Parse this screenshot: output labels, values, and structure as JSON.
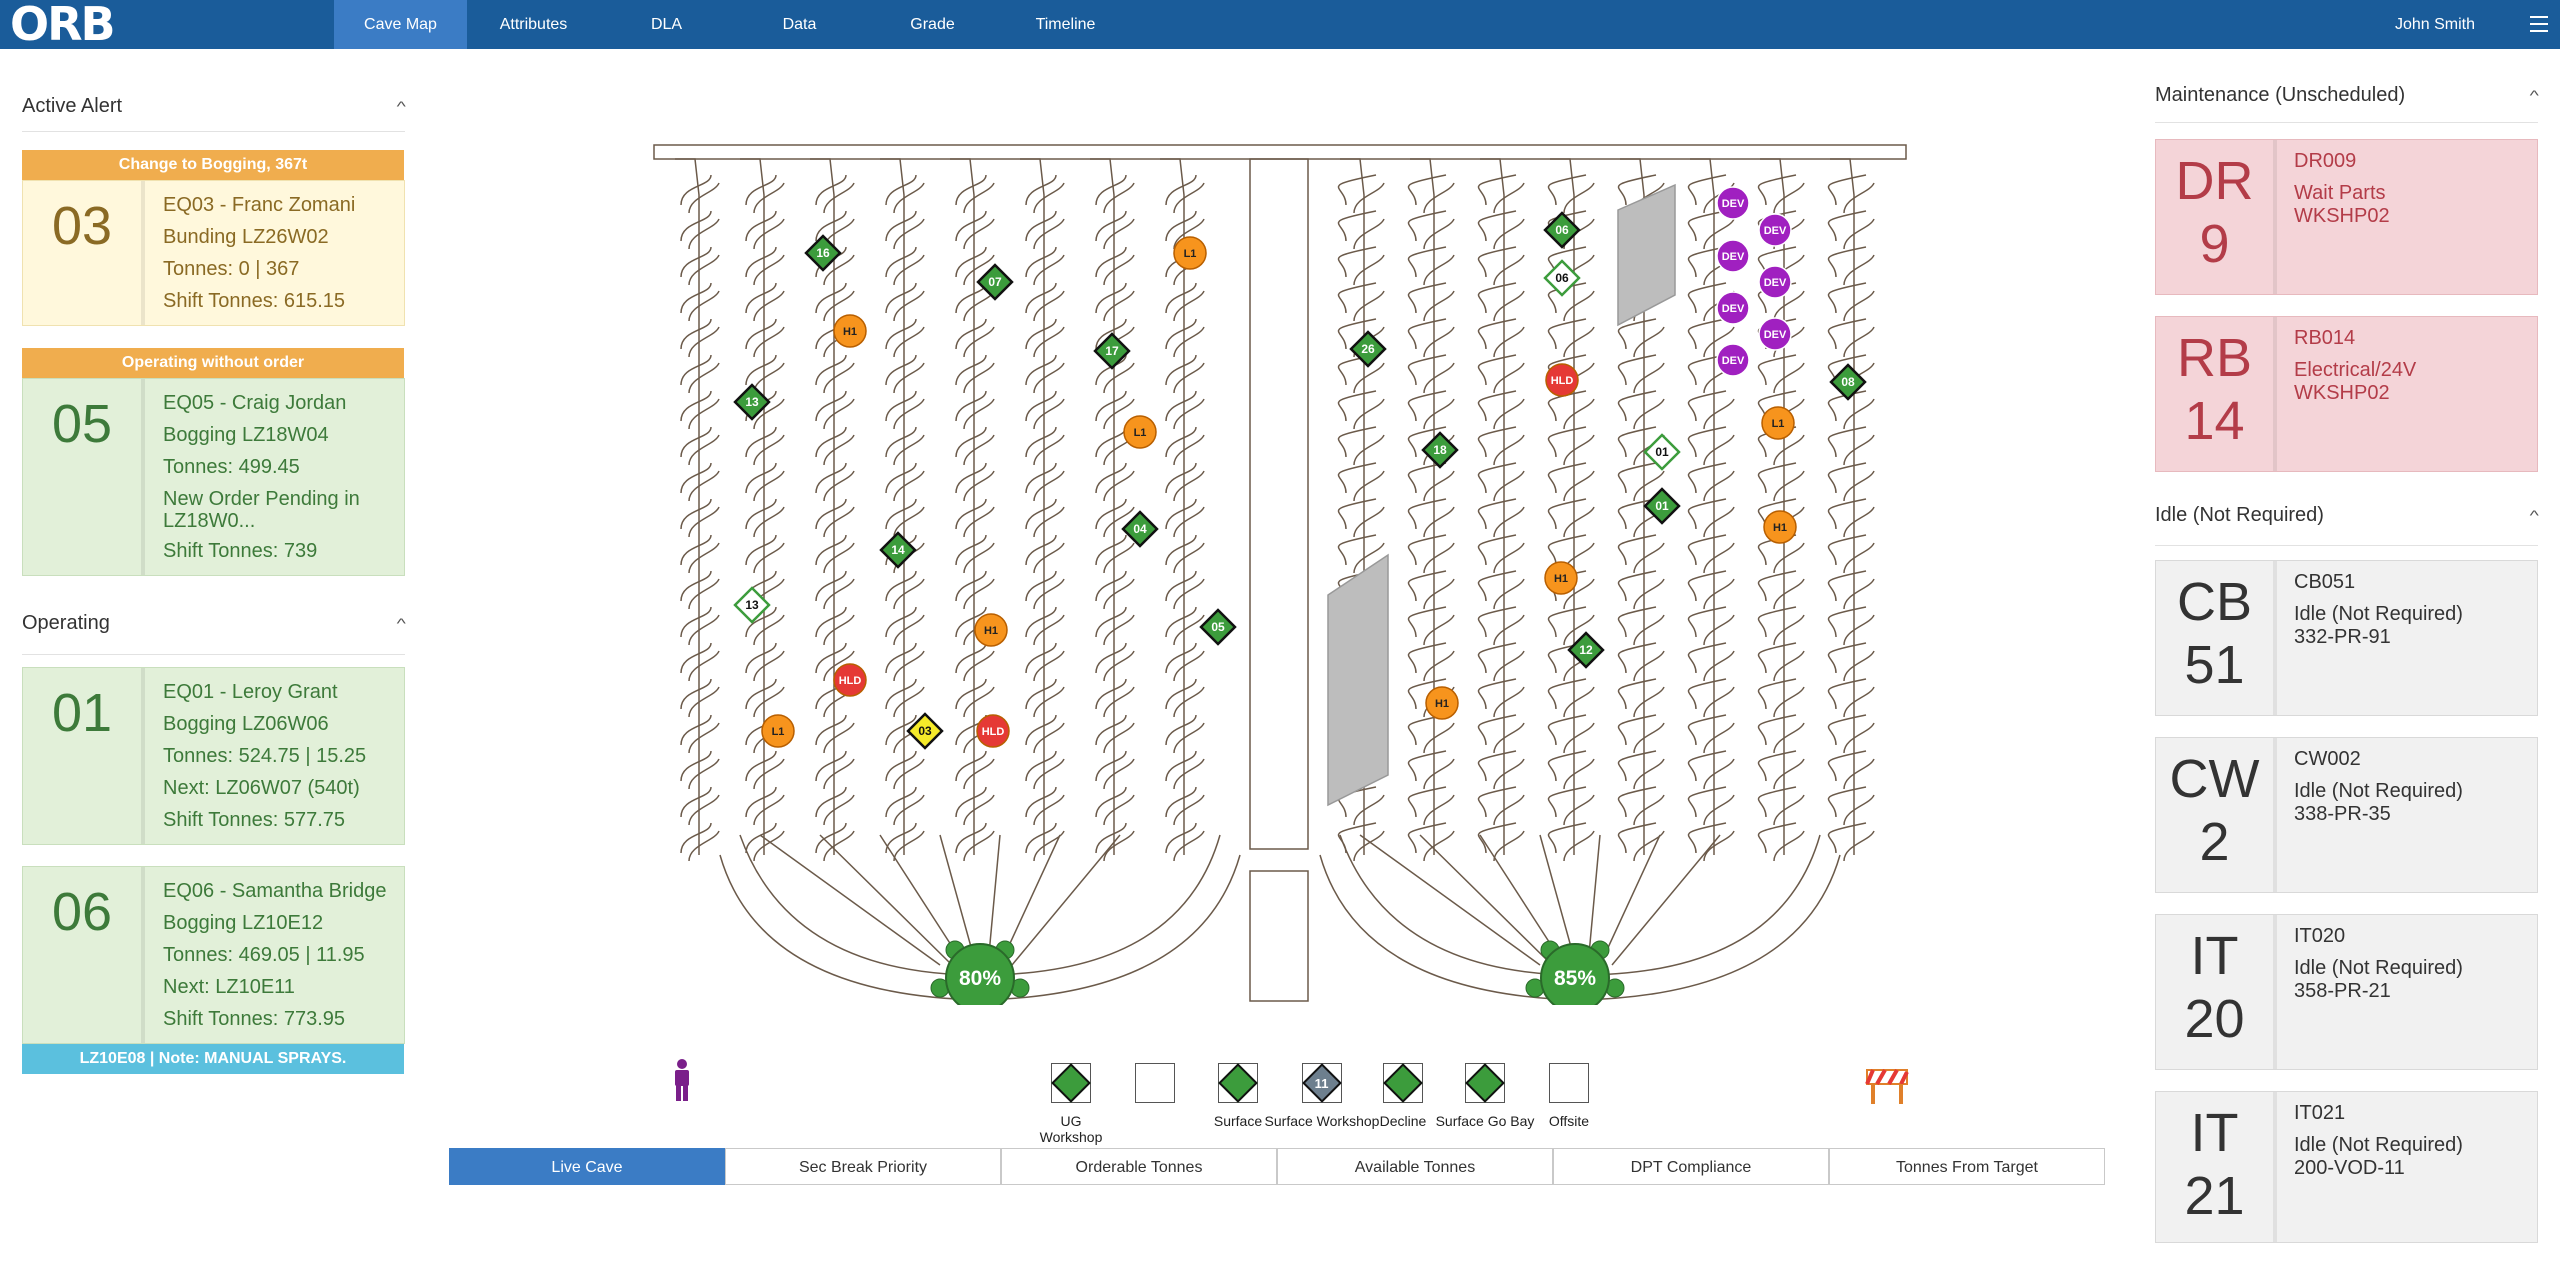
{
  "nav": {
    "logo": "ORB",
    "tabs": [
      "Cave Map",
      "Attributes",
      "DLA",
      "Data",
      "Grade",
      "Timeline"
    ],
    "user": "John Smith"
  },
  "active_alert": {
    "title": "Active Alert",
    "cards": [
      {
        "banner": "Change to Bogging, 367t",
        "num": "03",
        "lines": [
          "EQ03 - Franc Zomani",
          "Bunding LZ26W02",
          "Tonnes: 0 | 367",
          "Shift Tonnes: 615.15"
        ]
      },
      {
        "banner": "Operating without order",
        "num": "05",
        "lines": [
          "EQ05 - Craig Jordan",
          "Bogging LZ18W04",
          "Tonnes: 499.45",
          "New Order Pending in",
          "LZ18W0...",
          "Shift Tonnes: 739"
        ]
      }
    ]
  },
  "operating": {
    "title": "Operating",
    "cards": [
      {
        "num": "01",
        "lines": [
          "EQ01 - Leroy Grant",
          "Bogging LZ06W06",
          "Tonnes: 524.75 | 15.25",
          "Next: LZ06W07 (540t)",
          "Shift Tonnes: 577.75"
        ]
      },
      {
        "num": "06",
        "lines": [
          "EQ06 - Samantha Bridge",
          "Bogging LZ10E12",
          "Tonnes: 469.05 | 11.95",
          "Next: LZ10E11",
          "Shift Tonnes: 773.95"
        ]
      }
    ],
    "note": "LZ10E08 | Note: MANUAL SPRAYS."
  },
  "maintenance": {
    "title": "Maintenance (Unscheduled)",
    "cards": [
      {
        "code": "DR",
        "num": "9",
        "id": "DR009",
        "status": "Wait Parts",
        "loc": "WKSHP02"
      },
      {
        "code": "RB",
        "num": "14",
        "id": "RB014",
        "status": "Electrical/24V",
        "loc": "WKSHP02"
      }
    ]
  },
  "idle": {
    "title": "Idle (Not Required)",
    "cards": [
      {
        "code": "CB",
        "num": "51",
        "id": "CB051",
        "status": "Idle (Not Required)",
        "loc": "332-PR-91"
      },
      {
        "code": "CW",
        "num": "2",
        "id": "CW002",
        "status": "Idle (Not Required)",
        "loc": "338-PR-35"
      },
      {
        "code": "IT",
        "num": "20",
        "id": "IT020",
        "status": "Idle (Not Required)",
        "loc": "358-PR-21"
      },
      {
        "code": "IT",
        "num": "21",
        "id": "IT021",
        "status": "Idle (Not Required)",
        "loc": "200-VOD-11"
      }
    ]
  },
  "map": {
    "left_percent": "80%",
    "right_percent": "85%",
    "markers": [
      {
        "type": "diamond",
        "label": "16"
      },
      {
        "type": "diamond",
        "label": "07"
      },
      {
        "type": "diamond",
        "label": "17"
      },
      {
        "type": "diamond",
        "label": "13"
      },
      {
        "type": "diamond",
        "label": "14"
      },
      {
        "type": "diamond",
        "label": "04"
      },
      {
        "type": "diamond",
        "label": "05"
      },
      {
        "type": "diamond-outline",
        "label": "13"
      },
      {
        "type": "diamond-yellow",
        "label": "03"
      },
      {
        "type": "diamond",
        "label": "26"
      },
      {
        "type": "diamond",
        "label": "18"
      },
      {
        "type": "diamond",
        "label": "06"
      },
      {
        "type": "diamond-outline",
        "label": "06"
      },
      {
        "type": "diamond-outline",
        "label": "01"
      },
      {
        "type": "diamond",
        "label": "01"
      },
      {
        "type": "diamond",
        "label": "12"
      },
      {
        "type": "diamond",
        "label": "08"
      },
      {
        "type": "circle-orange",
        "label": "H1"
      },
      {
        "type": "circle-orange",
        "label": "L1"
      },
      {
        "type": "circle-orange",
        "label": "L1"
      },
      {
        "type": "circle-orange",
        "label": "H1"
      },
      {
        "type": "circle-orange",
        "label": "L1"
      },
      {
        "type": "circle-red",
        "label": "HLD"
      },
      {
        "type": "circle-red",
        "label": "HLD"
      },
      {
        "type": "circle-orange",
        "label": "H1"
      },
      {
        "type": "circle-orange",
        "label": "H1"
      },
      {
        "type": "circle-orange",
        "label": "H1"
      },
      {
        "type": "circle-orange",
        "label": "L1"
      },
      {
        "type": "circle-red",
        "label": "HLD"
      },
      {
        "type": "circle-purple",
        "label": "DEV"
      },
      {
        "type": "circle-purple",
        "label": "DEV"
      },
      {
        "type": "circle-purple",
        "label": "DEV"
      },
      {
        "type": "circle-purple",
        "label": "DEV"
      },
      {
        "type": "circle-purple",
        "label": "DEV"
      },
      {
        "type": "circle-purple",
        "label": "DEV"
      },
      {
        "type": "circle-purple",
        "label": "DEV"
      }
    ]
  },
  "legend": {
    "person_icon": "person-icon",
    "barrier_icon": "barrier-icon",
    "items": [
      {
        "label": "UG Workshop",
        "kind": "diamond"
      },
      {
        "label": "",
        "kind": "empty"
      },
      {
        "label": "Surface",
        "kind": "diamond"
      },
      {
        "label": "Surface Workshop",
        "kind": "diamond-11"
      },
      {
        "label": "Decline",
        "kind": "diamond"
      },
      {
        "label": "Surface Go Bay",
        "kind": "diamond"
      },
      {
        "label": "Offsite",
        "kind": "empty"
      }
    ],
    "dia_11": "11"
  },
  "buttons": [
    "Live Cave",
    "Sec Break Priority",
    "Orderable Tonnes",
    "Available Tonnes",
    "DPT Compliance",
    "Tonnes From Target"
  ],
  "colors": {
    "nav": "#1a5c9a",
    "nav_active": "#3b7cc5",
    "alert_banner": "#f0ad4e",
    "note_banner": "#5bc0de",
    "marker_green": "#3c9c3c",
    "marker_orange": "#f7941d",
    "marker_red": "#e53935",
    "marker_purple": "#a020c0"
  }
}
